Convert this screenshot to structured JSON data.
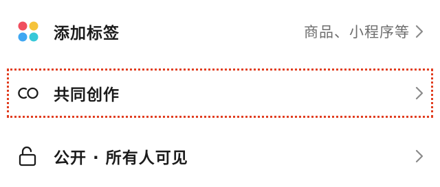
{
  "rows": {
    "tags": {
      "icon": "colorful-dots-icon",
      "label": "添加标签",
      "hint": "商品、小程序等",
      "chevron": "chevron-right-icon"
    },
    "cocreate": {
      "icon": "co-icon",
      "label": "共同创作",
      "chevron": "chevron-right-icon"
    },
    "visibility": {
      "icon": "unlock-icon",
      "label": "公开 · 所有人可见",
      "chevron": "chevron-right-icon"
    }
  },
  "colors": {
    "dot_red": "#f04e5e",
    "dot_yellow": "#f5c33b",
    "dot_blue": "#3fa7f2",
    "dot_cyan": "#37c8d8",
    "highlight": "#e13d1f",
    "label": "#1b1b1b",
    "hint": "#6e6e6e",
    "chevron": "#8a8a8a"
  }
}
